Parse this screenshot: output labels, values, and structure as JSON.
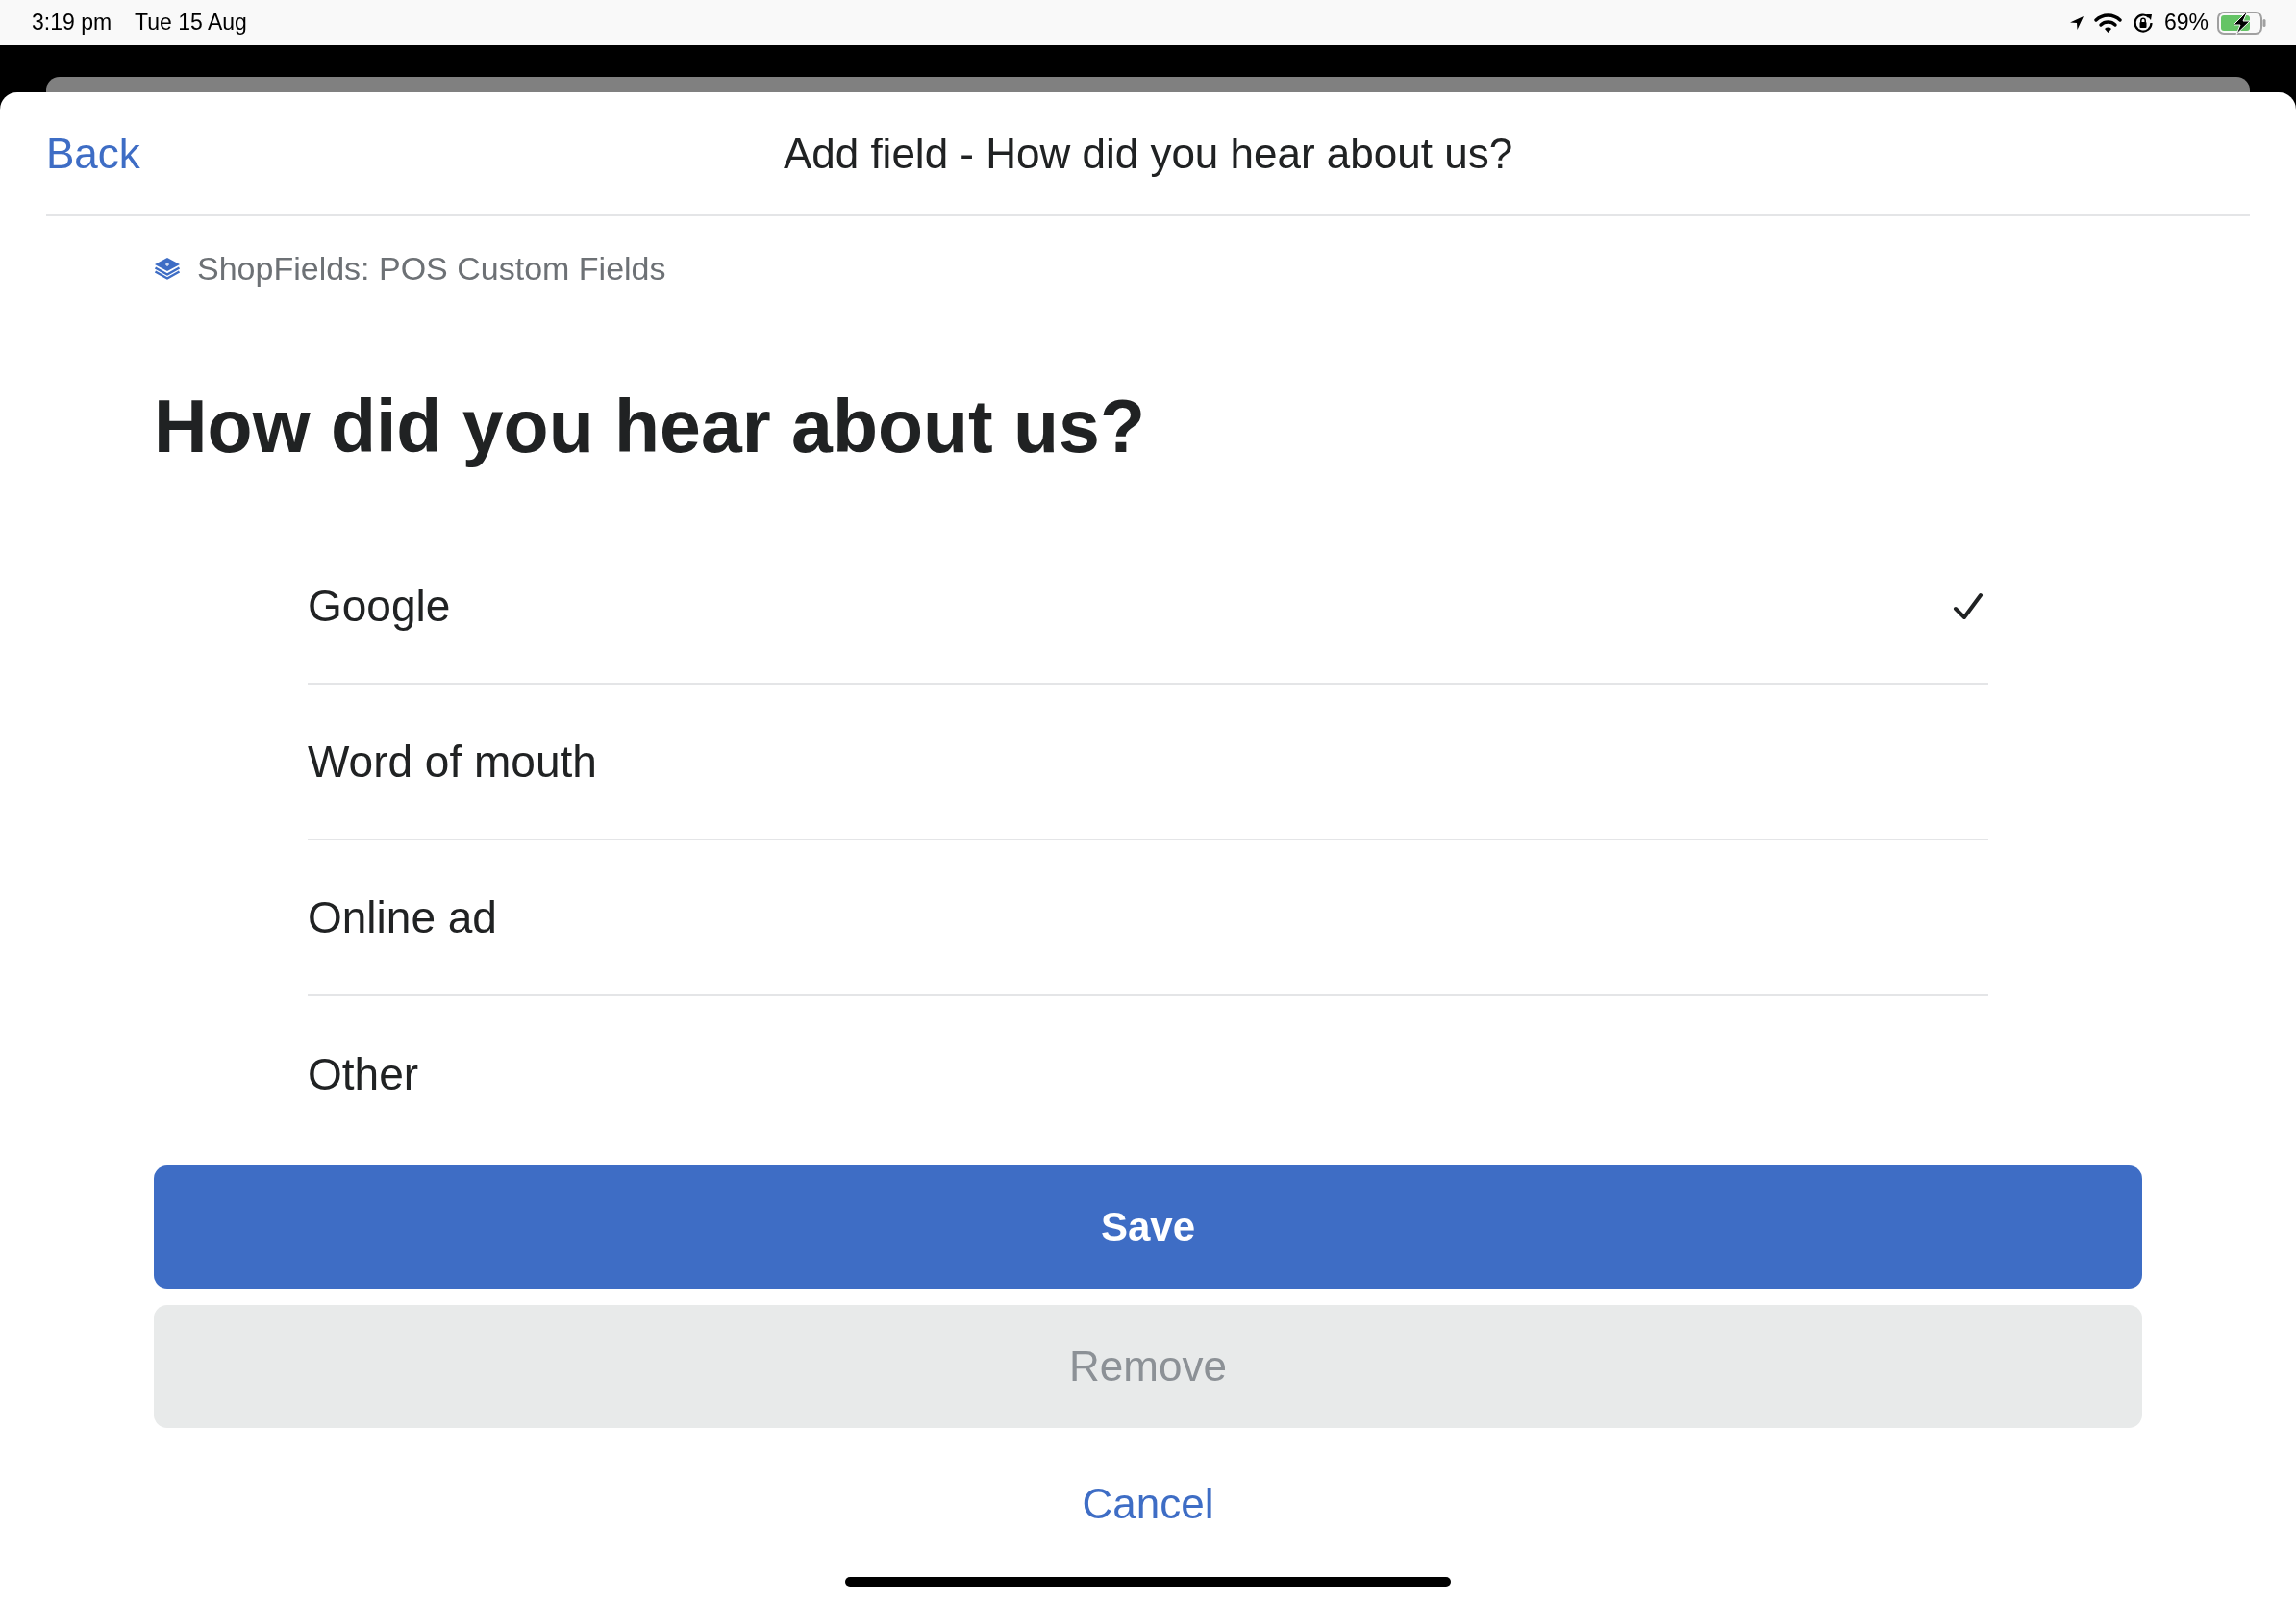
{
  "status_bar": {
    "time": "3:19 pm",
    "date": "Tue 15 Aug",
    "battery": "69%"
  },
  "header": {
    "back": "Back",
    "title": "Add field - How did you hear about us?"
  },
  "app": {
    "name": "ShopFields: POS Custom Fields"
  },
  "question": "How did you hear about us?",
  "options": [
    {
      "label": "Google",
      "selected": true
    },
    {
      "label": "Word of mouth",
      "selected": false
    },
    {
      "label": "Online ad",
      "selected": false
    },
    {
      "label": "Other",
      "selected": false
    }
  ],
  "actions": {
    "save": {
      "label": "Save"
    },
    "remove": {
      "label": "Remove",
      "disabled": true
    },
    "cancel": {
      "label": "Cancel"
    }
  }
}
